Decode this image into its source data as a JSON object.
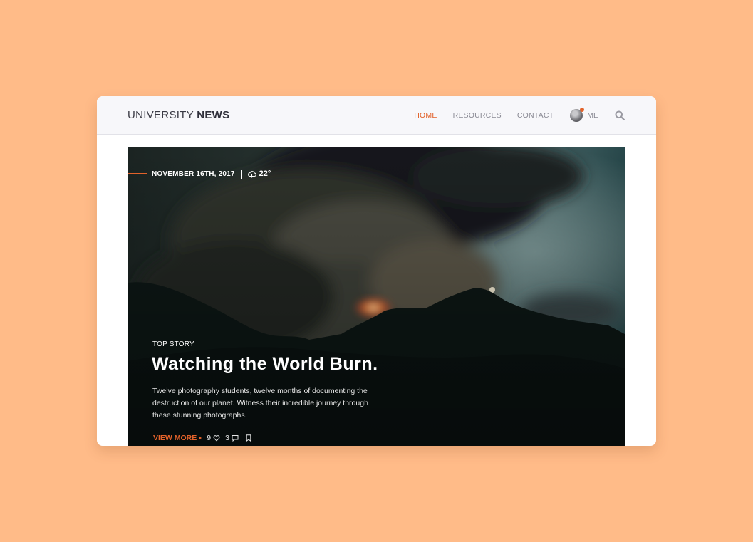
{
  "brand": {
    "prefix": "UNIVERSITY",
    "suffix": "NEWS"
  },
  "nav": {
    "items": [
      {
        "label": "HOME",
        "active": true
      },
      {
        "label": "RESOURCES",
        "active": false
      },
      {
        "label": "CONTACT",
        "active": false
      }
    ],
    "profile_label": "ME",
    "search_icon": "search-icon"
  },
  "hero": {
    "date": "NOVEMBER 16TH, 2017",
    "weather_icon": "cloud-icon",
    "temperature": "22°",
    "eyebrow": "TOP STORY",
    "title": "Watching the World Burn.",
    "summary": "Twelve photography students, twelve months of documenting the destruction of our planet. Witness their incredible journey through these stunning photographs.",
    "cta": "VIEW MORE",
    "likes": "9",
    "comments": "3",
    "bookmark_icon": "bookmark-icon"
  },
  "colors": {
    "background": "#ffbb88",
    "accent": "#e2622a",
    "card": "#ffffff",
    "header": "#f7f7fa"
  }
}
